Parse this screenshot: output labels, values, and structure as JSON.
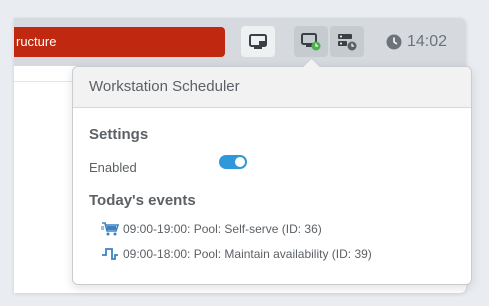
{
  "topbar": {
    "search_text": "ructure",
    "clock_time": "14:02",
    "search_color": "#c0290f"
  },
  "popup": {
    "title": "Workstation Scheduler",
    "settings": {
      "heading": "Settings",
      "enabled_label": "Enabled",
      "enabled": true
    },
    "events": {
      "heading": "Today's events",
      "items": [
        {
          "icon": "cart-icon",
          "text": "09:00-19:00: Pool: Self-serve (ID: 36)"
        },
        {
          "icon": "pulse-icon",
          "text": "09:00-18:00: Pool: Maintain availability (ID: 39)"
        }
      ]
    }
  },
  "colors": {
    "accent": "#2f98db",
    "icon_blue": "#3b82c4",
    "badge_green": "#4caf50"
  }
}
